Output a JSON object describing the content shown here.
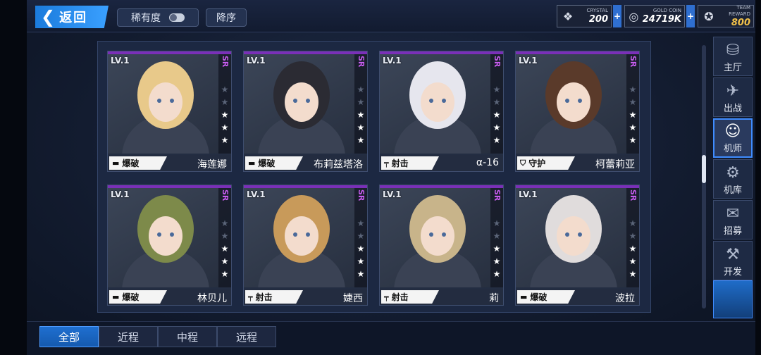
{
  "header": {
    "back_label": "返回",
    "rarity_sort_label": "稀有度",
    "order_label": "降序"
  },
  "resources": [
    {
      "tag": "CRYSTAL",
      "value": "200",
      "icon": "crystal-icon"
    },
    {
      "tag": "GOLD COIN",
      "value": "24719K",
      "icon": "gold-coin-icon"
    },
    {
      "tag": "TEAM REWARD",
      "value": "800",
      "icon": "team-reward-icon"
    }
  ],
  "cards": [
    {
      "level": "LV.1",
      "rarity": "SR",
      "stars": 3,
      "role": "爆破",
      "role_icon": "cannon-icon",
      "name": "海莲娜"
    },
    {
      "level": "LV.1",
      "rarity": "SR",
      "stars": 3,
      "role": "爆破",
      "role_icon": "cannon-icon",
      "name": "布莉兹塔洛"
    },
    {
      "level": "LV.1",
      "rarity": "SR",
      "stars": 3,
      "role": "射击",
      "role_icon": "rifle-icon",
      "name": "α-16"
    },
    {
      "level": "LV.1",
      "rarity": "SR",
      "stars": 3,
      "role": "守护",
      "role_icon": "shield-icon",
      "name": "柯蕾莉亚"
    },
    {
      "level": "LV.1",
      "rarity": "SR",
      "stars": 3,
      "role": "爆破",
      "role_icon": "cannon-icon",
      "name": "林贝儿"
    },
    {
      "level": "LV.1",
      "rarity": "SR",
      "stars": 3,
      "role": "射击",
      "role_icon": "rifle-icon",
      "name": "婕西"
    },
    {
      "level": "LV.1",
      "rarity": "SR",
      "stars": 3,
      "role": "射击",
      "role_icon": "rifle-icon",
      "name": "莉"
    },
    {
      "level": "LV.1",
      "rarity": "SR",
      "stars": 3,
      "role": "爆破",
      "role_icon": "cannon-icon",
      "name": "波拉"
    }
  ],
  "nav": [
    {
      "label": "主厅",
      "icon": "hall-icon",
      "active": false
    },
    {
      "label": "出战",
      "icon": "battle-icon",
      "active": false
    },
    {
      "label": "机师",
      "icon": "pilot-icon",
      "active": true
    },
    {
      "label": "机库",
      "icon": "hangar-icon",
      "active": false
    },
    {
      "label": "招募",
      "icon": "recruit-icon",
      "active": false
    },
    {
      "label": "开发",
      "icon": "develop-icon",
      "active": false
    }
  ],
  "tabs": [
    {
      "label": "全部",
      "active": true
    },
    {
      "label": "近程",
      "active": false
    },
    {
      "label": "中程",
      "active": false
    },
    {
      "label": "远程",
      "active": false
    }
  ],
  "colors": {
    "accent_blue": "#2f7fe0",
    "rarity_purple": "#c85cf0",
    "star_white": "#ffffff",
    "star_dim": "#5a6478"
  }
}
